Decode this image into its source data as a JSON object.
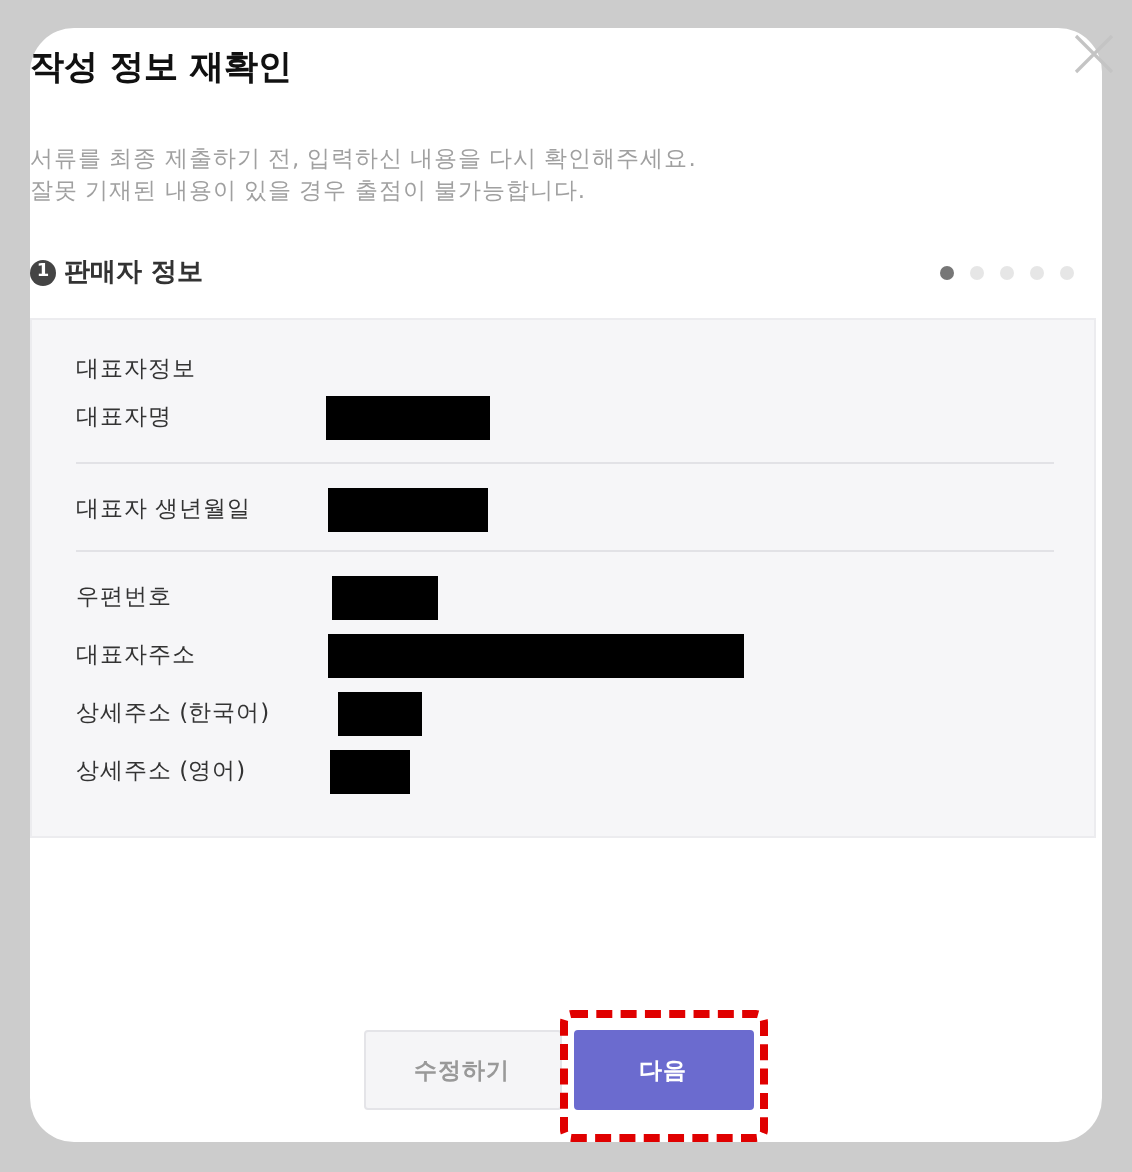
{
  "dialog": {
    "title": "작성 정보 재확인",
    "description": [
      "서류를 최종 제출하기 전, 입력하신 내용을 다시 확인해주세요.",
      "잘못 기재된 내용이 있을 경우 출점이 불가능합니다."
    ]
  },
  "section": {
    "number": "1",
    "title": "판매자 정보"
  },
  "steps": [
    {
      "selected": true
    },
    {
      "selected": false
    },
    {
      "selected": false
    },
    {
      "selected": false
    },
    {
      "selected": false
    }
  ],
  "groups": [
    {
      "title": "대표자정보",
      "rows": [
        {
          "label": "대표자명",
          "redacted": true
        }
      ]
    },
    {
      "rows": [
        {
          "label": "대표자 생년월일",
          "redacted": true
        }
      ]
    },
    {
      "rows": [
        {
          "label": "우편번호",
          "redacted": true
        },
        {
          "label": "대표자주소",
          "redacted": true
        },
        {
          "label": "상세주소 (한국어)",
          "redacted": true
        },
        {
          "label": "상세주소 (영어)",
          "redacted": true
        }
      ]
    }
  ],
  "buttons": [
    {
      "label": "수정하기",
      "kind": "secondary",
      "highlighted": false
    },
    {
      "label": "다음",
      "kind": "primary",
      "highlighted": true
    }
  ]
}
